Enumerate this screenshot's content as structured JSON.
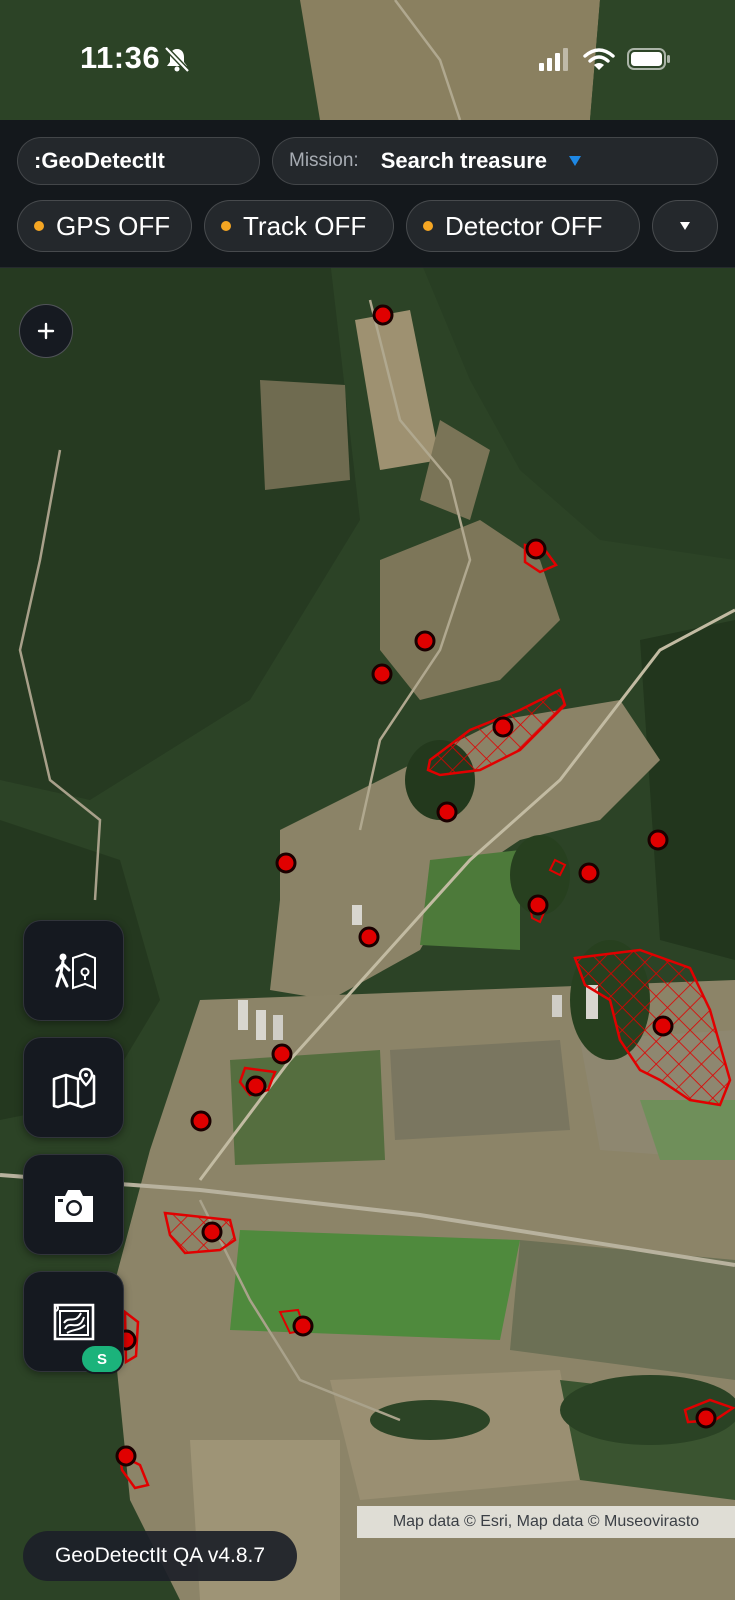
{
  "status_bar": {
    "time": "11:36",
    "icons": [
      "bell-slash-icon",
      "cellular-signal-icon",
      "wifi-icon",
      "battery-icon"
    ]
  },
  "header": {
    "app_name": ":GeoDetectIt",
    "mission_label": "Mission:",
    "mission_value": "Search treasure"
  },
  "toggles": {
    "gps": "GPS OFF",
    "track": "Track OFF",
    "detector": "Detector OFF",
    "status_dot_color": "#f5a623"
  },
  "map": {
    "attribution": "Map data © Esri, Map data © Museovirasto",
    "marker_color": "#e00000",
    "area_outline_color": "#e10000",
    "icons": [
      "plus-icon",
      "hiker-map-icon",
      "map-pin-icon",
      "camera-icon",
      "survey-map-icon"
    ],
    "survey_badge": "S"
  },
  "footer": {
    "version": "GeoDetectIt QA v4.8.7"
  }
}
